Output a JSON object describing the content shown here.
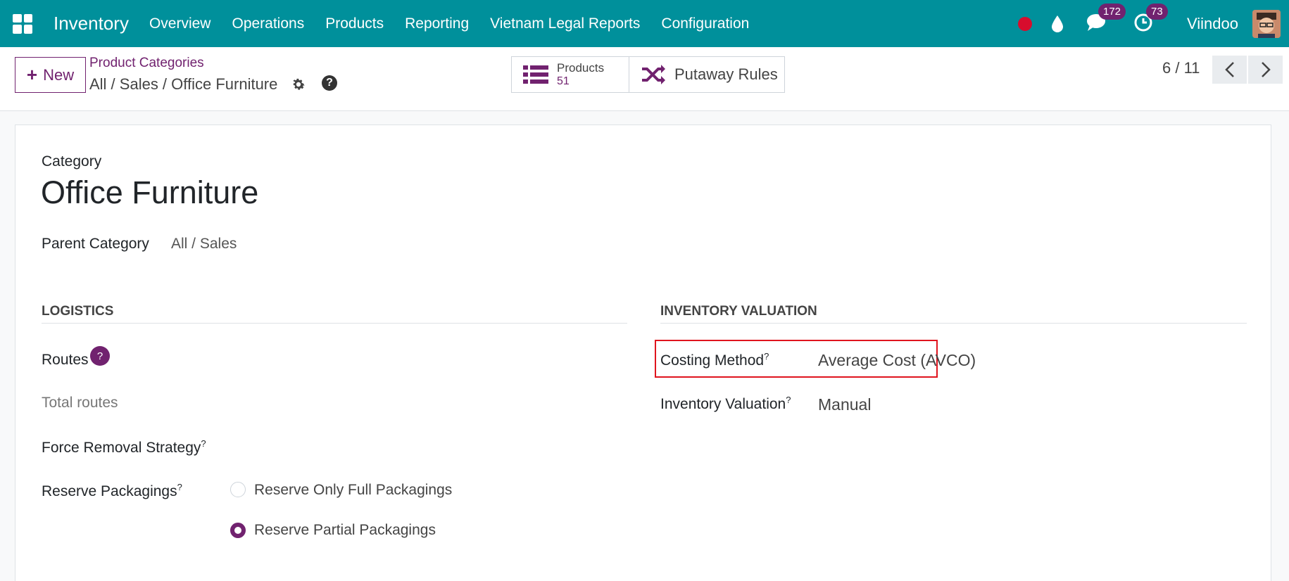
{
  "nav": {
    "app_name": "Inventory",
    "menu": [
      "Overview",
      "Operations",
      "Products",
      "Reporting",
      "Vietnam Legal Reports",
      "Configuration"
    ],
    "messages_count": "172",
    "activities_count": "73",
    "user_name": "Viindoo",
    "colors": {
      "bar": "#00909b",
      "badge": "#71226f",
      "recording": "#d70d2d"
    }
  },
  "control": {
    "new_label": "New",
    "breadcrumb_parent": "Product Categories",
    "breadcrumb_current": "All / Sales / Office Furniture",
    "smart_products_label": "Products",
    "smart_products_value": "51",
    "smart_putaway_label": "Putaway Rules",
    "pager": "6 / 11"
  },
  "form": {
    "category_label": "Category",
    "category_name": "Office Furniture",
    "parent_category_label": "Parent Category",
    "parent_category_value": "All / Sales",
    "logistics_title": "LOGISTICS",
    "routes_label": "Routes",
    "total_routes": "Total routes",
    "force_removal_label": "Force Removal Strategy",
    "reserve_packagings_label": "Reserve Packagings",
    "reserve_options": [
      "Reserve Only Full Packagings",
      "Reserve Partial Packagings"
    ],
    "reserve_selected": "Reserve Partial Packagings",
    "valuation_title": "INVENTORY VALUATION",
    "costing_method_label": "Costing Method",
    "costing_method_value": "Average Cost (AVCO)",
    "inventory_valuation_label": "Inventory Valuation",
    "inventory_valuation_value": "Manual",
    "tooltip_mark": "?"
  }
}
